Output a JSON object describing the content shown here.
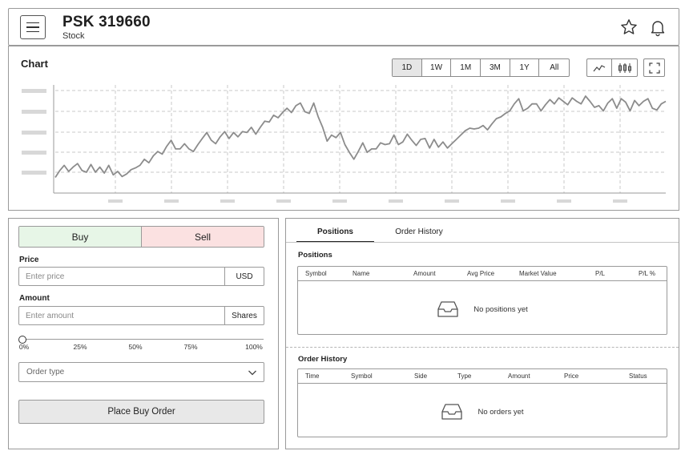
{
  "header": {
    "title": "PSK 319660",
    "subtitle": "Stock",
    "icons": [
      "menu-icon",
      "star-icon",
      "bell-icon"
    ]
  },
  "chart": {
    "title": "Chart",
    "ranges": [
      "1D",
      "1W",
      "1M",
      "3M",
      "1Y",
      "All"
    ],
    "active_range": "1D",
    "chart_type_icons": [
      "line-chart-icon",
      "candlestick-icon",
      "fullscreen-icon"
    ]
  },
  "chart_data": {
    "type": "line",
    "title": "",
    "xlabel": "",
    "ylabel": "",
    "grid": true,
    "ylim": [
      0,
      1
    ],
    "x": [
      0,
      1,
      2,
      3,
      4,
      5,
      6,
      7,
      8,
      9,
      10,
      11,
      12,
      13,
      14,
      15,
      16,
      17,
      18,
      19,
      20,
      21,
      22,
      23,
      24,
      25,
      26,
      27,
      28,
      29,
      30,
      31,
      32,
      33,
      34,
      35,
      36,
      37,
      38,
      39,
      40,
      41,
      42,
      43,
      44,
      45,
      46,
      47,
      48,
      49,
      50,
      51,
      52,
      53,
      54,
      55,
      56,
      57,
      58,
      59,
      60,
      61,
      62,
      63,
      64,
      65,
      66,
      67,
      68,
      69,
      70,
      71,
      72,
      73,
      74,
      75,
      76,
      77,
      78,
      79,
      80,
      81,
      82,
      83,
      84,
      85,
      86,
      87,
      88,
      89,
      90,
      91,
      92,
      93,
      94,
      95,
      96,
      97,
      98,
      99,
      100,
      101,
      102,
      103,
      104,
      105,
      106,
      107,
      108,
      109,
      110,
      111,
      112,
      113,
      114,
      115,
      116
    ],
    "series": [
      {
        "values": [
          0.06,
          0.14,
          0.2,
          0.13,
          0.18,
          0.22,
          0.14,
          0.12,
          0.21,
          0.12,
          0.18,
          0.11,
          0.2,
          0.09,
          0.13,
          0.07,
          0.1,
          0.15,
          0.17,
          0.2,
          0.27,
          0.23,
          0.31,
          0.36,
          0.33,
          0.42,
          0.49,
          0.39,
          0.39,
          0.45,
          0.39,
          0.36,
          0.44,
          0.51,
          0.58,
          0.49,
          0.45,
          0.53,
          0.59,
          0.51,
          0.58,
          0.53,
          0.59,
          0.58,
          0.64,
          0.56,
          0.64,
          0.71,
          0.7,
          0.78,
          0.75,
          0.81,
          0.86,
          0.81,
          0.89,
          0.92,
          0.82,
          0.8,
          0.92,
          0.76,
          0.64,
          0.48,
          0.55,
          0.52,
          0.58,
          0.44,
          0.35,
          0.27,
          0.36,
          0.46,
          0.35,
          0.39,
          0.39,
          0.46,
          0.44,
          0.45,
          0.55,
          0.44,
          0.47,
          0.56,
          0.49,
          0.43,
          0.5,
          0.51,
          0.4,
          0.5,
          0.41,
          0.47,
          0.4,
          0.45,
          0.5,
          0.55,
          0.6,
          0.63,
          0.62,
          0.63,
          0.66,
          0.61,
          0.68,
          0.74,
          0.76,
          0.8,
          0.83,
          0.91,
          0.97,
          0.83,
          0.86,
          0.91,
          0.91,
          0.83,
          0.9,
          0.96,
          0.91,
          0.98,
          0.94,
          0.9,
          0.98,
          0.94,
          0.91,
          1.0,
          0.94,
          0.87,
          0.89,
          0.83,
          0.92,
          0.97,
          0.86,
          0.97,
          0.93,
          0.83,
          0.95,
          0.89,
          0.94,
          0.97,
          0.86,
          0.84,
          0.91,
          0.94
        ]
      }
    ]
  },
  "order_form": {
    "buy_label": "Buy",
    "sell_label": "Sell",
    "price_label": "Price",
    "price_placeholder": "Enter price",
    "price_unit": "USD",
    "amount_label": "Amount",
    "amount_placeholder": "Enter amount",
    "amount_unit": "Shares",
    "slider_value": 0,
    "slider_ticks": [
      "0%",
      "25%",
      "50%",
      "75%",
      "100%"
    ],
    "order_type_placeholder": "Order type",
    "submit_label": "Place Buy Order",
    "buy_color": "#e7f6e7",
    "sell_color": "#fbe1e1"
  },
  "portfolio": {
    "tabs": [
      "Positions",
      "Order History"
    ],
    "active_tab": "Positions",
    "positions": {
      "title": "Positions",
      "columns": [
        "Symbol",
        "Name",
        "Amount",
        "Avg Price",
        "Market Value",
        "P/L",
        "P/L %"
      ],
      "rows": [],
      "empty_text": "No positions yet"
    },
    "orders": {
      "title": "Order History",
      "columns": [
        "Time",
        "Symbol",
        "Side",
        "Type",
        "Amount",
        "Price",
        "Status"
      ],
      "rows": [],
      "empty_text": "No orders yet"
    }
  }
}
